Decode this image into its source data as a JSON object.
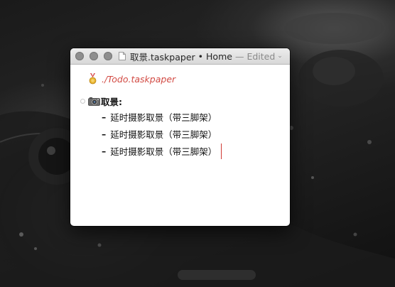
{
  "window": {
    "title_file": "取景.taskpaper",
    "title_separator": "•",
    "title_location": "Home",
    "title_dash": "—",
    "title_status": "Edited",
    "chevron_icon": "chevron-down-icon"
  },
  "document": {
    "link": {
      "icon": "medal-icon",
      "text": "./Todo.taskpaper"
    },
    "project": {
      "icon": "camera-icon",
      "text": "取景:"
    },
    "tasks": [
      {
        "bullet": "–",
        "text": "延时摄影取景（带三脚架）"
      },
      {
        "bullet": "–",
        "text": "延时摄影取景（带三脚架）"
      },
      {
        "bullet": "–",
        "text": "延时摄影取景（带三脚架）"
      }
    ]
  },
  "colors": {
    "link": "#d24a43",
    "cursor": "#d03a33",
    "titlebar": "#dcdcdc"
  }
}
